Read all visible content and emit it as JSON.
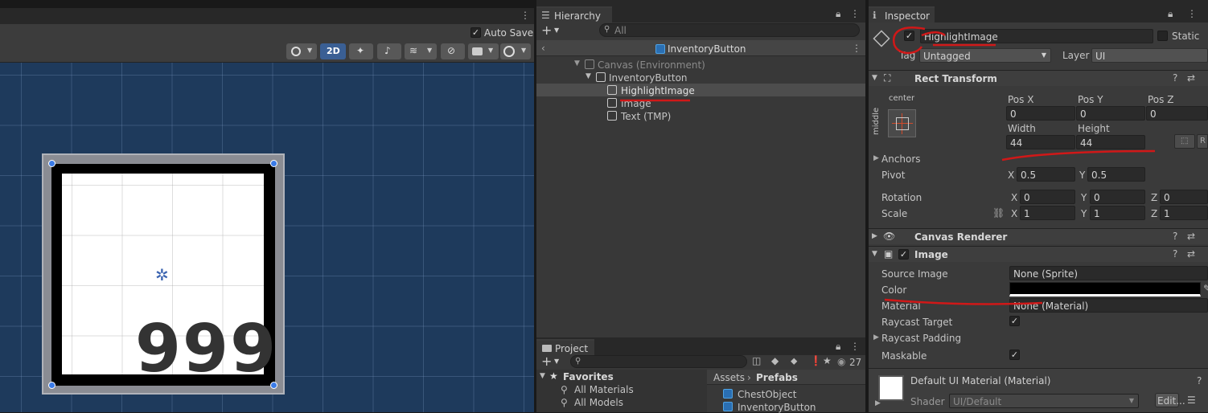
{
  "scene": {
    "auto_save_label": "Auto Save",
    "mode_2d": "2D",
    "counter_text": "999"
  },
  "hierarchy": {
    "tab": "Hierarchy",
    "search_placeholder": "All",
    "prefab_title": "InventoryButton",
    "items": [
      "Canvas (Environment)",
      "InventoryButton",
      "HighlightImage",
      "Image",
      "Text (TMP)"
    ]
  },
  "project": {
    "tab": "Project",
    "count": "27",
    "favorites_label": "Favorites",
    "favorites": [
      "All Materials",
      "All Models"
    ],
    "breadcrumb": [
      "Assets",
      "Prefabs"
    ],
    "assets": [
      "ChestObject",
      "InventoryButton"
    ]
  },
  "inspector": {
    "tab": "Inspector",
    "object_name": "HighlightImage",
    "static_label": "Static",
    "tag_label": "Tag",
    "tag_value": "Untagged",
    "layer_label": "Layer",
    "layer_value": "UI",
    "rect_transform": {
      "title": "Rect Transform",
      "anchor_h": "center",
      "anchor_v": "middle",
      "pos_x_label": "Pos X",
      "pos_y_label": "Pos Y",
      "pos_z_label": "Pos Z",
      "pos_x": "0",
      "pos_y": "0",
      "pos_z": "0",
      "width_label": "Width",
      "height_label": "Height",
      "width": "44",
      "height": "44",
      "anchors_label": "Anchors",
      "pivot_label": "Pivot",
      "pivot_x": "0.5",
      "pivot_y": "0.5",
      "rotation_label": "Rotation",
      "rot_x": "0",
      "rot_y": "0",
      "rot_z": "0",
      "scale_label": "Scale",
      "scale_x": "1",
      "scale_y": "1",
      "scale_z": "1",
      "x": "X",
      "y": "Y",
      "z": "Z",
      "r_button": "R"
    },
    "canvas_renderer": {
      "title": "Canvas Renderer"
    },
    "image": {
      "title": "Image",
      "source_image_label": "Source Image",
      "source_image": "None (Sprite)",
      "color_label": "Color",
      "color": "#000000",
      "material_label": "Material",
      "material": "None (Material)",
      "raycast_target_label": "Raycast Target",
      "raycast_padding_label": "Raycast Padding",
      "maskable_label": "Maskable"
    },
    "material": {
      "title": "Default UI Material (Material)",
      "shader_label": "Shader",
      "shader": "UI/Default",
      "edit_label": "Edit..."
    }
  },
  "colors": {
    "accent": "#4d7fc3",
    "annotation": "#d01818",
    "scene_bg": "#1e3a5c"
  }
}
